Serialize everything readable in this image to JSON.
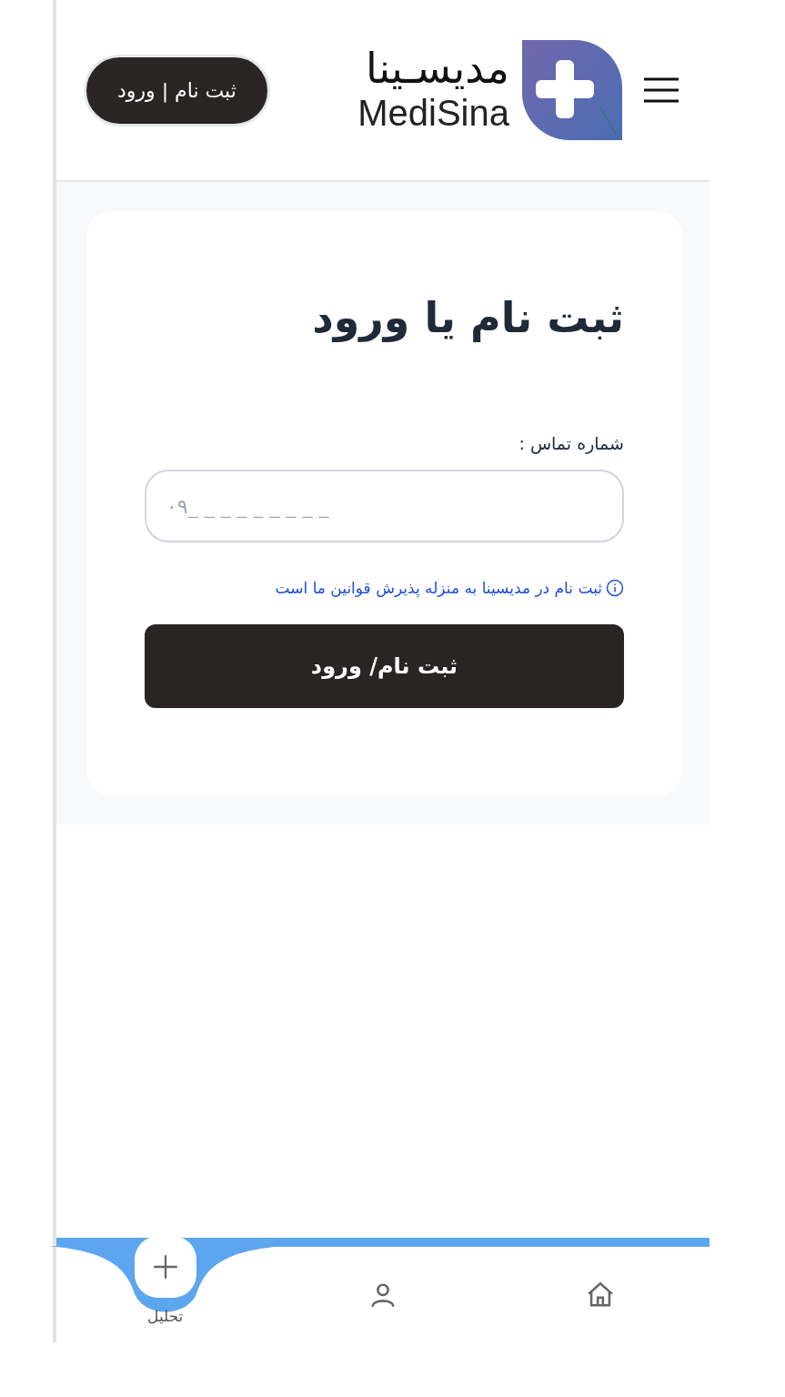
{
  "header": {
    "logo_fa": "مدیسـینا",
    "logo_en": "MediSina",
    "login_button": "ثبت نام | ورود"
  },
  "form": {
    "title": "ثبت نام یا ورود",
    "phone_label": "شماره تماس :",
    "phone_placeholder": "۰۹_ _ _ _ _ _ _ _ _",
    "terms_note": "ثبت نام در مدیسینا به منزله پذیرش قوانین ما است",
    "submit": "ثبت نام/ ورود"
  },
  "bottom_nav": [
    {
      "kind": "home",
      "selected": false
    },
    {
      "kind": "profile",
      "selected": false
    },
    {
      "kind": "add",
      "label": "تحلیل",
      "selected": true
    }
  ]
}
